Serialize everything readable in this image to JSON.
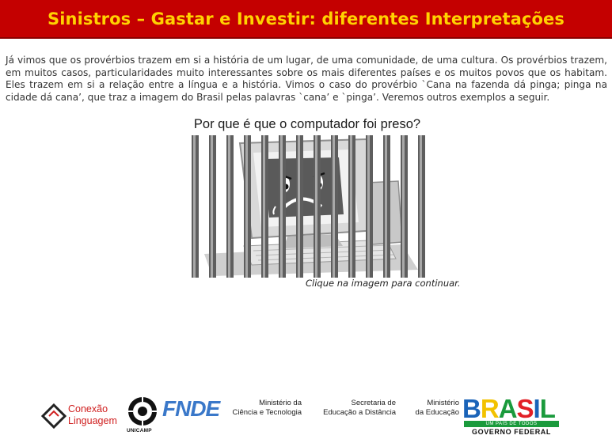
{
  "header": {
    "title": "Sinistros – Gastar e Investir: diferentes Interpretações"
  },
  "intro": {
    "text": "Já vimos que os provérbios trazem em si a história de um lugar, de uma comunidade, de uma cultura. Os provérbios trazem, em muitos casos, particularidades muito interessantes sobre os mais diferentes países e os muitos povos que os habitam. Eles trazem em si a relação entre a língua e a história. Vimos o caso do provérbio `Cana na fazenda dá pinga; pinga na cidade dá cana’, que traz a imagem do Brasil pelas palavras `cana’ e `pinga’. Veremos outros exemplos a seguir."
  },
  "illustration": {
    "question": "Por que é que o computador foi preso?",
    "caption": "Clique na imagem para continuar."
  },
  "footer": {
    "conexao_line1": "Conexão",
    "conexao_line2": "Linguagem",
    "unicamp": "UNICAMP",
    "fnde": "FNDE",
    "ministerio_ciencia_line1": "Ministério da",
    "ministerio_ciencia_line2": "Ciência e Tecnologia",
    "secretaria_line1": "Secretaria de",
    "secretaria_line2": "Educação a Distância",
    "ministerio_educacao_line1": "Ministério",
    "ministerio_educacao_line2": "da Educação",
    "brasil_letters": [
      "B",
      "R",
      "A",
      "S",
      "I",
      "L"
    ],
    "brasil_slogan": "UM PAÍS DE TODOS",
    "governo": "GOVERNO FEDERAL"
  },
  "colors": {
    "header_bg": "#c40000",
    "header_text": "#ffd200",
    "conexao_red": "#d02020",
    "fnde_blue": "#3a78c9"
  }
}
